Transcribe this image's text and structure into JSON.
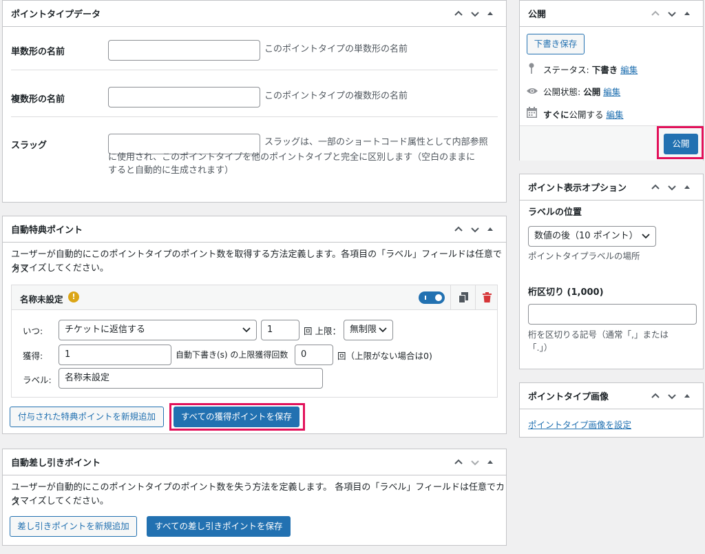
{
  "point_type_data": {
    "title": "ポイントタイプデータ",
    "singular_label": "単数形の名前",
    "singular_value": "",
    "singular_desc": "このポイントタイプの単数形の名前",
    "plural_label": "複数形の名前",
    "plural_value": "",
    "plural_desc": "このポイントタイプの複数形の名前",
    "slug_label": "スラッグ",
    "slug_value": "",
    "slug_desc_1": "スラッグは、一部のショートコード属性として内部参照",
    "slug_desc_2": "に使用され、このポイントタイプを他のポイントタイプと完全に区別します（空白のままに",
    "slug_desc_3": "すると自動的に生成されます）"
  },
  "auto_award": {
    "title": "自動特典ポイント",
    "desc_1": "ユーザーが自動的にこのポイントタイプのポイント数を取得する方法定義します。各項目の「ラベル」フィールドは任意でカス",
    "desc_2": "タマイズしてください。",
    "item": {
      "name": "名称未設定",
      "toggle_on": true,
      "when_label": "いつ:",
      "when_value": "チケットに返信する",
      "times_value": "1",
      "limit_label": "回 上限：",
      "limit_value": "無制限",
      "earn_label": "獲得:",
      "earn_value": "1",
      "auto_draft_label": "自動下書き(s) の上限獲得回数",
      "max_value": "0",
      "max_note": "回（上限がない場合は0)",
      "label_label": "ラベル:",
      "label_value": "名称未設定"
    },
    "add_button": "付与された特典ポイントを新規追加",
    "save_button": "すべての獲得ポイントを保存"
  },
  "auto_deduct": {
    "title": "自動差し引きポイント",
    "desc_1": "ユーザーが自動的にこのポイントタイプのポイント数を失う方法を定義します。 各項目の「ラベル」フィールドは任意でカス",
    "desc_2": "タマイズしてください。",
    "add_button": "差し引きポイントを新規追加",
    "save_button": "すべての差し引きポイントを保存"
  },
  "publish": {
    "title": "公開",
    "draft_button": "下書き保存",
    "status_label": "ステータス:",
    "status_value": "下書き",
    "visibility_label": "公開状態:",
    "visibility_value": "公開",
    "schedule_bold": "すぐに",
    "schedule_rest": "公開する",
    "edit_link": "編集",
    "publish_button": "公開"
  },
  "display_options": {
    "title": "ポイント表示オプション",
    "label_position_title": "ラベルの位置",
    "label_position_value": "数値の後（10 ポイント）",
    "label_position_desc": "ポイントタイプラベルの場所",
    "separator_title": "桁区切り (1,000)",
    "separator_value": "",
    "separator_desc_1": "桁を区切りる記号（通常「,」または",
    "separator_desc_2": "「.」）"
  },
  "point_image": {
    "title": "ポイントタイプ画像",
    "set_link": "ポイントタイプ画像を設定"
  },
  "colors": {
    "accent": "#2271b1",
    "highlight": "#e2115a",
    "warning": "#dba617",
    "trash": "#d63638"
  }
}
